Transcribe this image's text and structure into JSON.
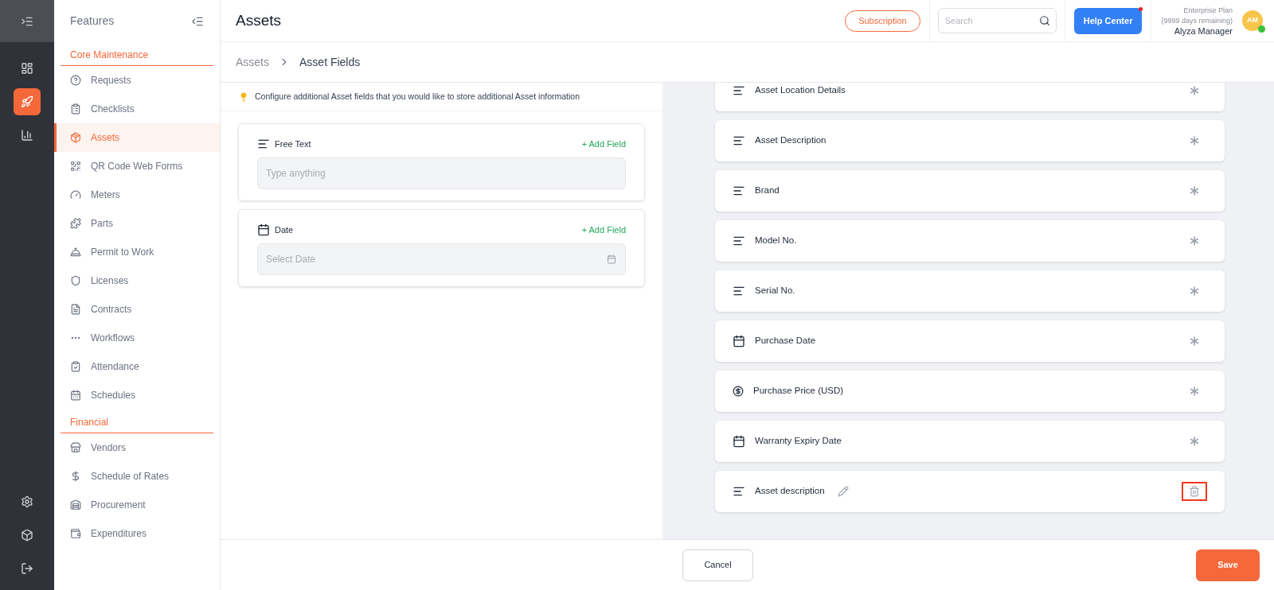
{
  "rail": {
    "items": [
      {
        "selected": false
      },
      {
        "selected": true
      },
      {
        "selected": false
      }
    ],
    "bottom_items": [
      {
        "selected": false
      },
      {
        "selected": false
      },
      {
        "selected": false
      }
    ]
  },
  "sidebar": {
    "title": "Features",
    "sections": [
      {
        "title": "Core Maintenance",
        "items": [
          {
            "label": "Requests",
            "selected": false
          },
          {
            "label": "Checklists",
            "selected": false
          },
          {
            "label": "Assets",
            "selected": true
          },
          {
            "label": "QR Code Web Forms",
            "selected": false
          },
          {
            "label": "Meters",
            "selected": false
          },
          {
            "label": "Parts",
            "selected": false
          },
          {
            "label": "Permit to Work",
            "selected": false
          },
          {
            "label": "Licenses",
            "selected": false
          },
          {
            "label": "Contracts",
            "selected": false
          },
          {
            "label": "Workflows",
            "selected": false
          },
          {
            "label": "Attendance",
            "selected": false
          },
          {
            "label": "Schedules",
            "selected": false
          }
        ]
      },
      {
        "title": "Financial",
        "items": [
          {
            "label": "Vendors",
            "selected": false
          },
          {
            "label": "Schedule of Rates",
            "selected": false
          },
          {
            "label": "Procurement",
            "selected": false
          },
          {
            "label": "Expenditures",
            "selected": false
          }
        ]
      }
    ]
  },
  "header": {
    "title": "Assets",
    "subscription": "Subscription",
    "search": {
      "placeholder": "Search"
    },
    "help": "Help Center",
    "help_notification": true,
    "plan": "Enterprise Plan",
    "plan_remaining": "(9999 days remaining)",
    "user": "Alyza Manager",
    "avatar": "AM",
    "online": true
  },
  "breadcrumb": [
    "Assets",
    "Asset Fields"
  ],
  "hint": "Configure additional Asset fields that you would like to store additional Asset information",
  "field_types": [
    {
      "kind": "text",
      "label": "Free Text",
      "action": "+ Add Field",
      "placeholder": "Type anything"
    },
    {
      "kind": "date",
      "label": "Date",
      "action": "+ Add Field",
      "placeholder": "Select Date"
    }
  ],
  "fields": [
    {
      "kind": "text",
      "label": "Asset Location Details",
      "custom": false,
      "highlighted": false
    },
    {
      "kind": "text",
      "label": "Asset Description",
      "custom": false,
      "highlighted": false
    },
    {
      "kind": "text",
      "label": "Brand",
      "custom": false,
      "highlighted": false
    },
    {
      "kind": "text",
      "label": "Model No.",
      "custom": false,
      "highlighted": false
    },
    {
      "kind": "text",
      "label": "Serial No.",
      "custom": false,
      "highlighted": false
    },
    {
      "kind": "date",
      "label": "Purchase Date",
      "custom": false,
      "highlighted": false
    },
    {
      "kind": "currency",
      "label": "Purchase Price (USD)",
      "custom": false,
      "highlighted": false
    },
    {
      "kind": "date",
      "label": "Warranty Expiry Date",
      "custom": false,
      "highlighted": false
    },
    {
      "kind": "text",
      "label": "Asset description",
      "custom": true,
      "highlighted": true
    }
  ],
  "footer": {
    "cancel": "Cancel",
    "save": "Save"
  }
}
